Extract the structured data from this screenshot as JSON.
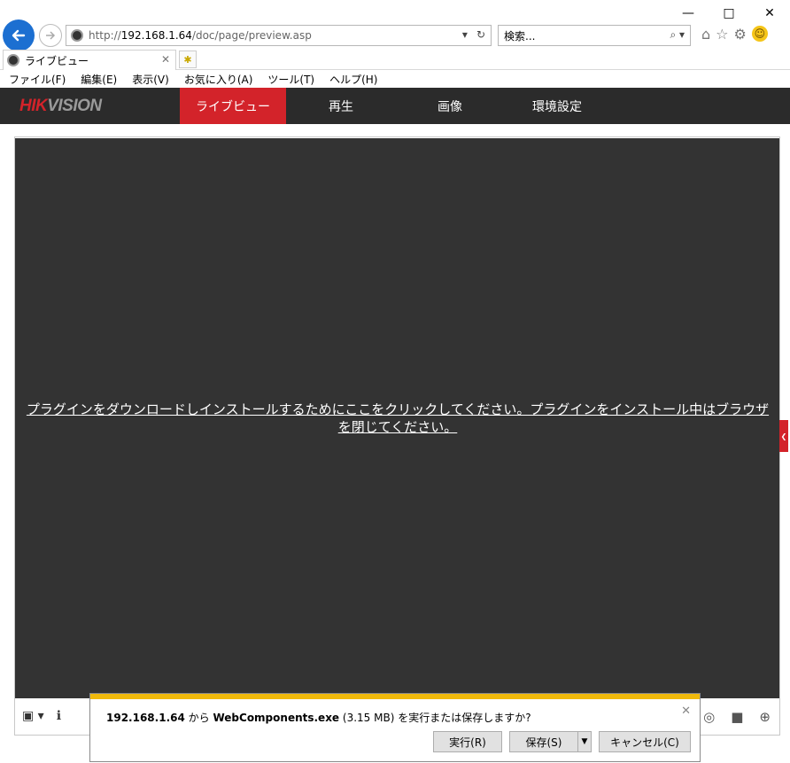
{
  "browser": {
    "url_prefix": "http://",
    "url_host": "192.168.1.64",
    "url_path": "/doc/page/preview.asp",
    "search_placeholder": "検索...",
    "tab_title": "ライブビュー",
    "menu": [
      "ファイル(F)",
      "編集(E)",
      "表示(V)",
      "お気に入り(A)",
      "ツール(T)",
      "ヘルプ(H)"
    ]
  },
  "app": {
    "logo_red": "HIK",
    "logo_grey": "VISION",
    "nav": [
      "ライブビュー",
      "再生",
      "画像",
      "環境設定"
    ],
    "active_color": "#d3232a"
  },
  "content": {
    "plugin_message": "プラグインをダウンロードしインストールするためにここをクリックしてください。プラグインをインストール中はブラウザを閉じてください。"
  },
  "download": {
    "host": "192.168.1.64",
    "from": " から ",
    "file": "WebComponents.exe",
    "size": " (3.15 MB) ",
    "question": "を実行または保存しますか?",
    "run_label": "実行(R)",
    "save_label": "保存(S)",
    "cancel_label": "キャンセル(C)"
  }
}
